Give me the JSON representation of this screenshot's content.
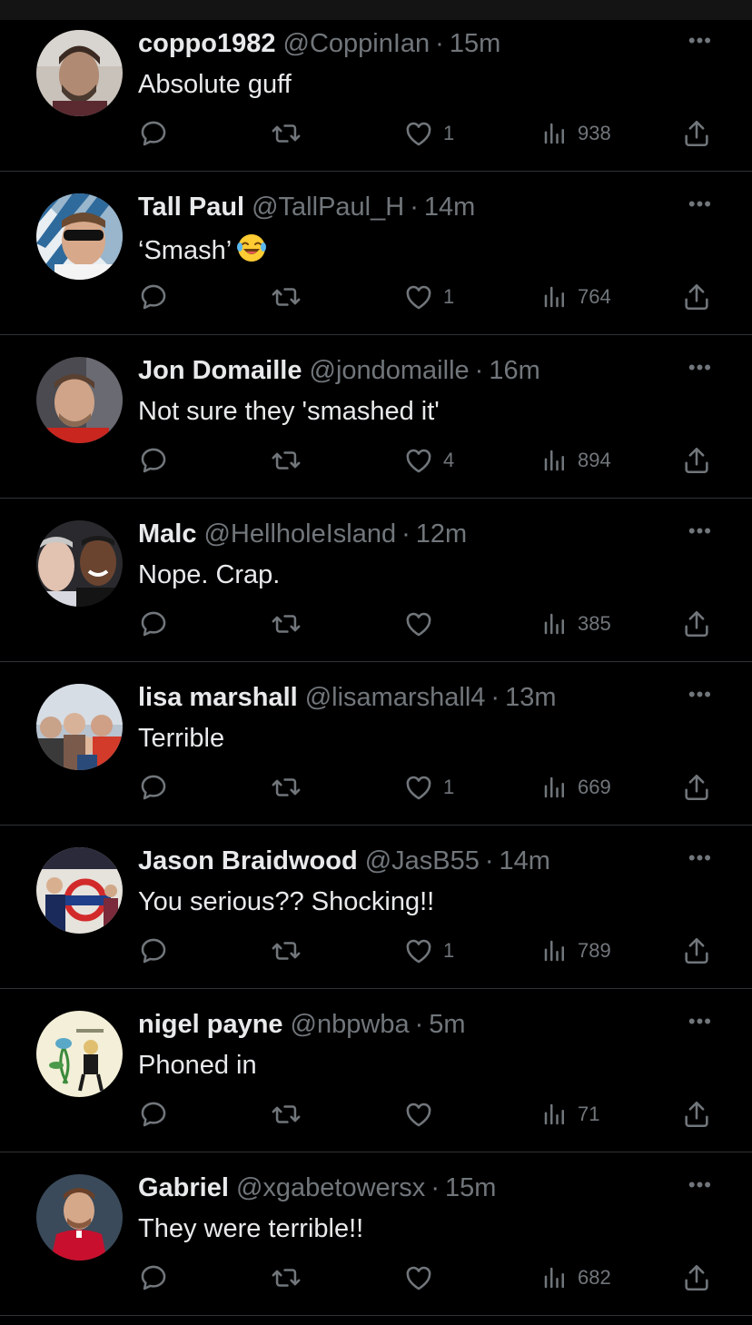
{
  "icons": {
    "reply": "reply-icon",
    "retweet": "retweet-icon",
    "like": "heart-icon",
    "views": "views-icon",
    "share": "share-icon",
    "more": "more-icon"
  },
  "colors": {
    "background": "#000000",
    "primary_text": "#e7e9ea",
    "secondary_text": "#71767b",
    "divider": "#2f3336"
  },
  "more_label": "•••",
  "separator": "·",
  "tweets": [
    {
      "name": "coppo1982",
      "handle": "@CoppinIan",
      "time": "15m",
      "text": "Absolute guff",
      "likes": "1",
      "views": "938"
    },
    {
      "name": "Tall Paul",
      "handle": "@TallPaul_H",
      "time": "14m",
      "text": "‘Smash’",
      "likes": "1",
      "views": "764"
    },
    {
      "name": "Jon Domaille",
      "handle": "@jondomaille",
      "time": "16m",
      "text": "Not sure they 'smashed it'",
      "likes": "4",
      "views": "894"
    },
    {
      "name": "Malc",
      "handle": "@HellholeIsland",
      "time": "12m",
      "text": "Nope. Crap.",
      "likes": "",
      "views": "385"
    },
    {
      "name": "lisa marshall",
      "handle": "@lisamarshall4",
      "time": "13m",
      "text": "Terrible",
      "likes": "1",
      "views": "669"
    },
    {
      "name": "Jason Braidwood",
      "handle": "@JasB55",
      "time": "14m",
      "text": "You serious?? Shocking!!",
      "likes": "1",
      "views": "789"
    },
    {
      "name": "nigel payne",
      "handle": "@nbpwba",
      "time": "5m",
      "text": "Phoned in",
      "likes": "",
      "views": "71"
    },
    {
      "name": "Gabriel",
      "handle": "@xgabetowersx",
      "time": "15m",
      "text": "They were terrible!!",
      "likes": "",
      "views": "682"
    }
  ]
}
